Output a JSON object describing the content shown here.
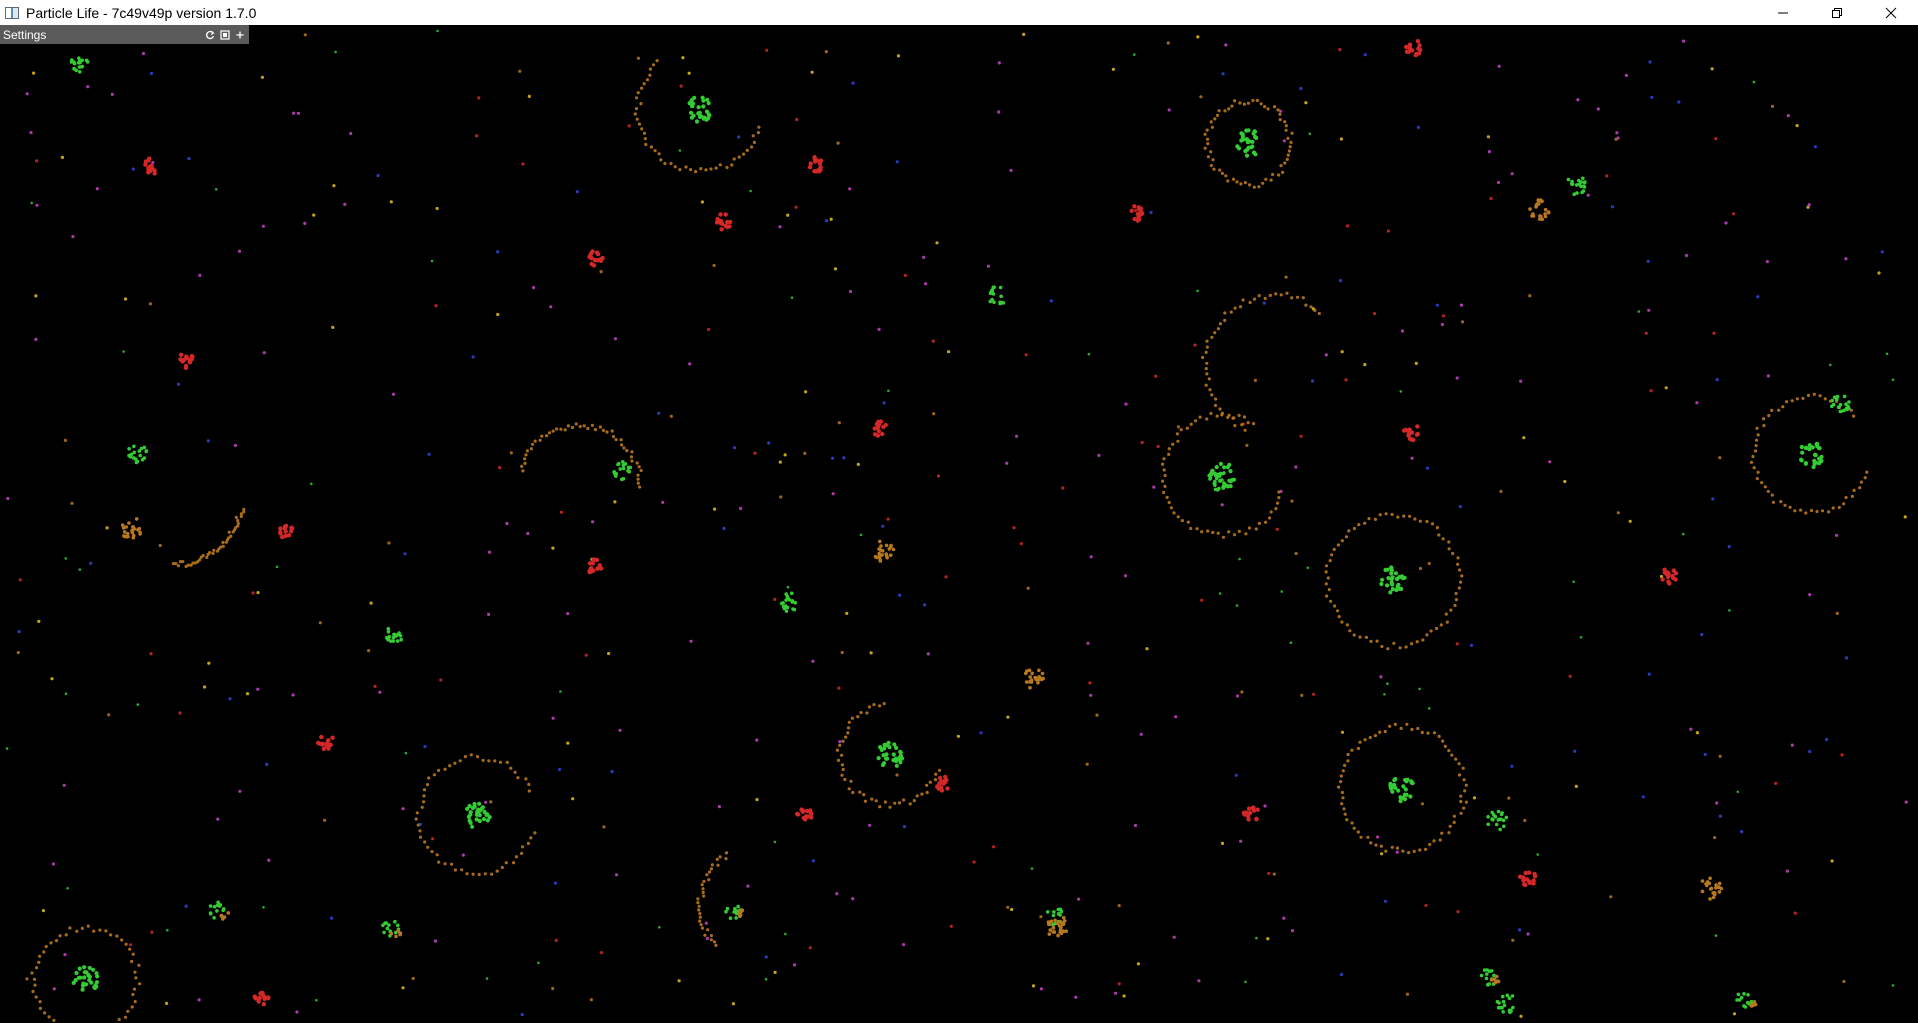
{
  "window": {
    "title": "Particle Life - 7c49v49p version 1.7.0",
    "icons": [
      "app-icon",
      "minimize-icon",
      "restore-icon",
      "close-icon"
    ]
  },
  "settings_panel": {
    "label": "Settings",
    "icons": [
      "refresh-icon",
      "detach-icon",
      "expand-icon"
    ]
  },
  "colors": {
    "background": "#000000",
    "titlebar": "#ffffff",
    "settings_bar": "#5a5a5a",
    "particle_green": "#33cc33",
    "particle_orange": "#b8781e",
    "particle_red": "#d42828",
    "particle_magenta": "#c844c8",
    "particle_blue": "#3344dd",
    "particle_yellow": "#e6c21a"
  }
}
